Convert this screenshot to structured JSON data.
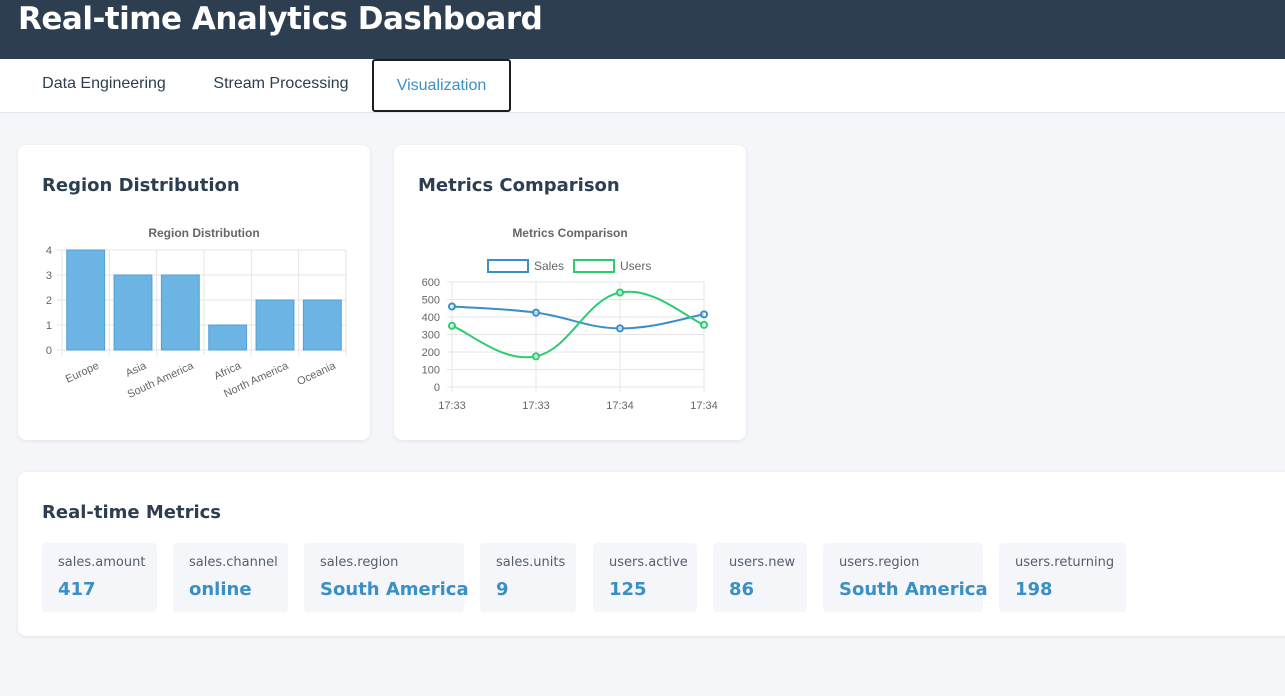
{
  "header": {
    "title": "Real-time Analytics Dashboard"
  },
  "tabs": [
    {
      "label": "Data Engineering",
      "active": false
    },
    {
      "label": "Stream Processing",
      "active": false
    },
    {
      "label": "Visualization",
      "active": true
    }
  ],
  "region_card": {
    "title": "Region Distribution"
  },
  "metrics_card": {
    "title": "Metrics Comparison"
  },
  "realtime": {
    "title": "Real-time Metrics",
    "items": [
      {
        "label": "sales.amount",
        "value": "417"
      },
      {
        "label": "sales.channel",
        "value": "online"
      },
      {
        "label": "sales.region",
        "value": "South America"
      },
      {
        "label": "sales.units",
        "value": "9"
      },
      {
        "label": "users.active",
        "value": "125"
      },
      {
        "label": "users.new",
        "value": "86"
      },
      {
        "label": "users.region",
        "value": "South America"
      },
      {
        "label": "users.returning",
        "value": "198"
      }
    ]
  },
  "colors": {
    "header_bg": "#2c3e50",
    "accent": "#3a8fc4",
    "bar": "#6cb4e4",
    "sales_line": "#3a8fc4",
    "users_line": "#2ecc71"
  },
  "chart_data": [
    {
      "type": "bar",
      "title": "Region Distribution",
      "categories": [
        "Europe",
        "Asia",
        "South America",
        "Africa",
        "North America",
        "Oceania"
      ],
      "values": [
        4,
        3,
        3,
        1,
        2,
        2
      ],
      "ylim": [
        0,
        4
      ],
      "yticks": [
        "0",
        "1",
        "2",
        "3",
        "4"
      ],
      "grid": true,
      "legend": "none"
    },
    {
      "type": "line",
      "title": "Metrics Comparison",
      "categories": [
        "17:33",
        "17:33",
        "17:34",
        "17:34"
      ],
      "series": [
        {
          "name": "Sales",
          "values": [
            460,
            425,
            335,
            415
          ]
        },
        {
          "name": "Users",
          "values": [
            350,
            175,
            540,
            355
          ]
        }
      ],
      "ylim": [
        0,
        600
      ],
      "yticks": [
        "0",
        "100",
        "200",
        "300",
        "400",
        "500",
        "600"
      ],
      "grid": true,
      "legend": "top"
    }
  ]
}
